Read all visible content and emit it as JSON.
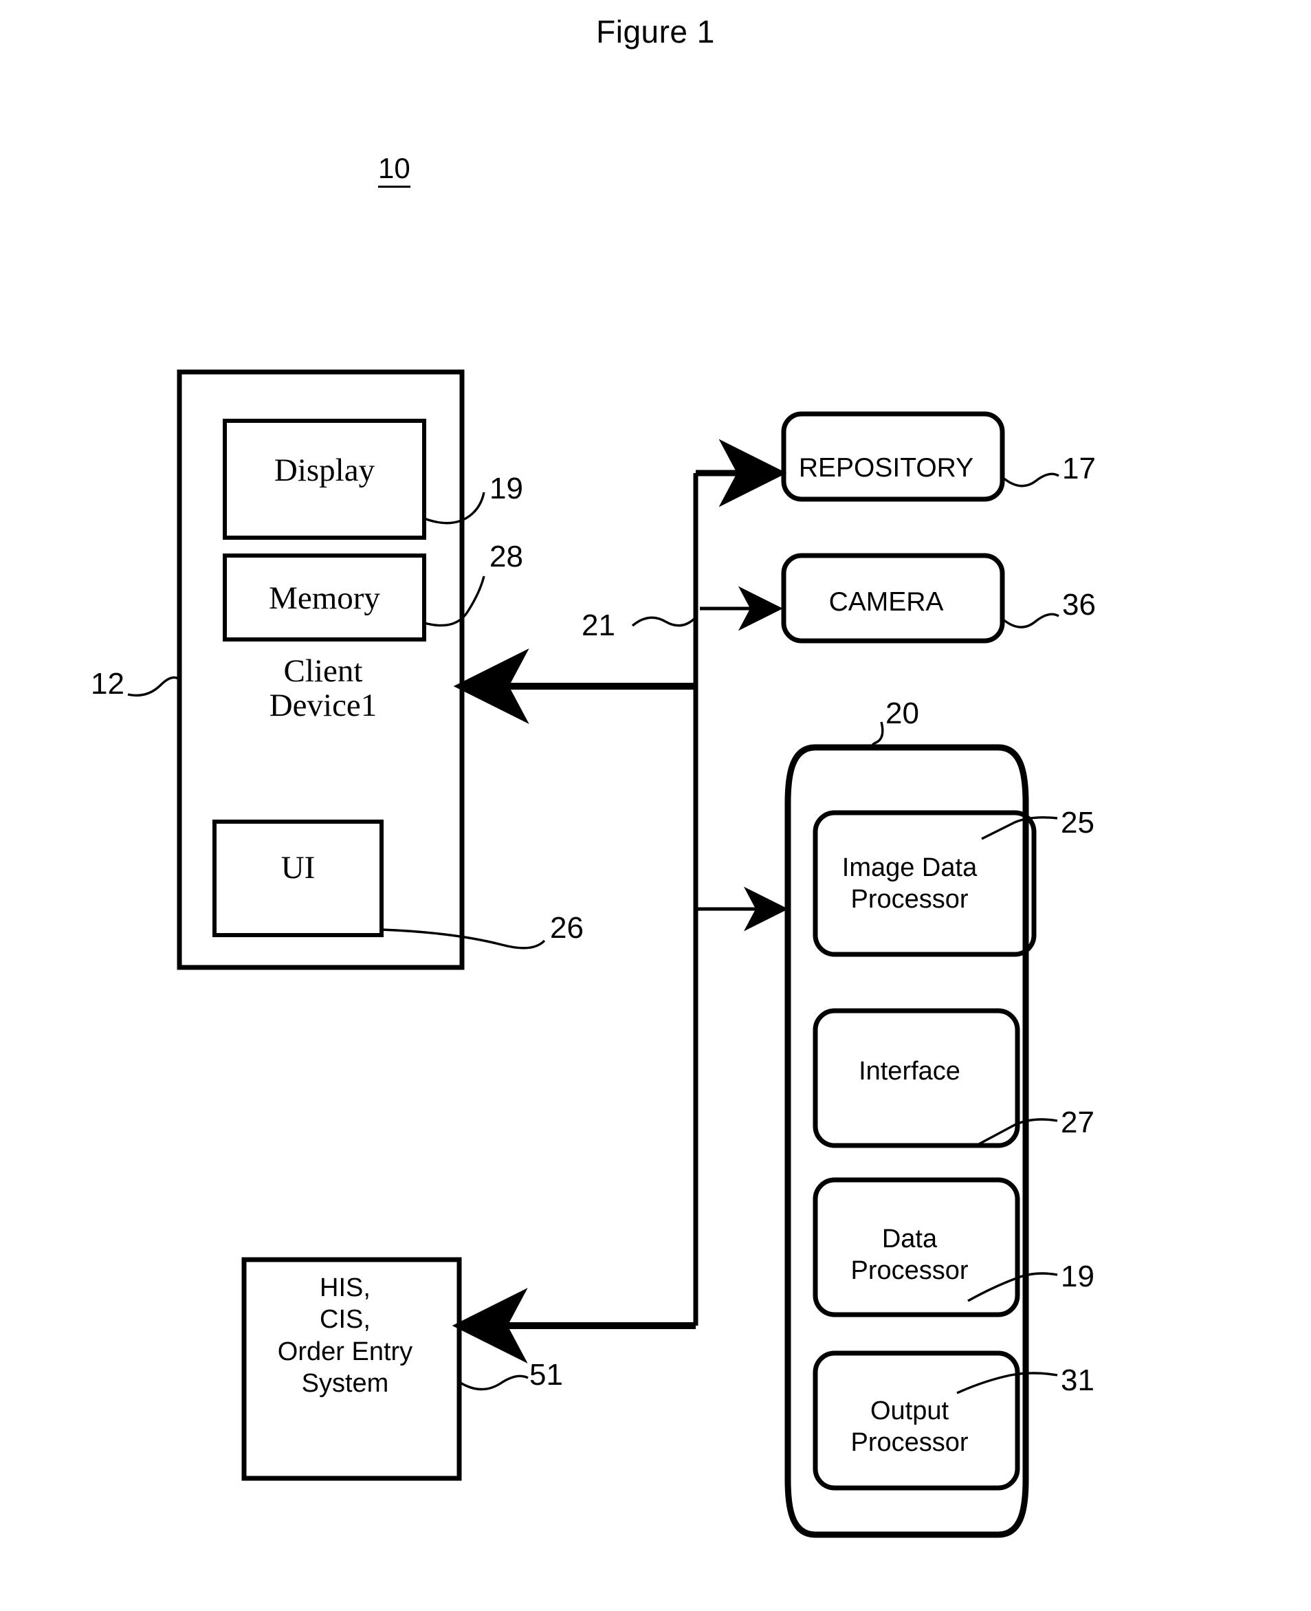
{
  "figure": {
    "title": "Figure 1",
    "system_ref": "10"
  },
  "client_device": {
    "ref": "12",
    "title": "Client\nDevice1",
    "blocks": [
      {
        "label": "Display",
        "ref": "19"
      },
      {
        "label": "Memory",
        "ref": "28"
      },
      {
        "label": "UI",
        "ref": "26"
      }
    ]
  },
  "bus": {
    "ref": "21"
  },
  "peripherals": [
    {
      "label": "REPOSITORY",
      "ref": "17"
    },
    {
      "label": "CAMERA",
      "ref": "36"
    }
  ],
  "server": {
    "ref": "20",
    "modules": [
      {
        "label": "Image Data\nProcessor",
        "ref": "25"
      },
      {
        "label": "Interface",
        "ref": "27"
      },
      {
        "label": "Data\nProcessor",
        "ref": "19"
      },
      {
        "label": "Output\nProcessor",
        "ref": "31"
      }
    ]
  },
  "external_system": {
    "label": "HIS,\nCIS,\nOrder Entry\nSystem",
    "ref": "51"
  },
  "colors": {
    "ink": "#000000",
    "paper": "#ffffff"
  }
}
